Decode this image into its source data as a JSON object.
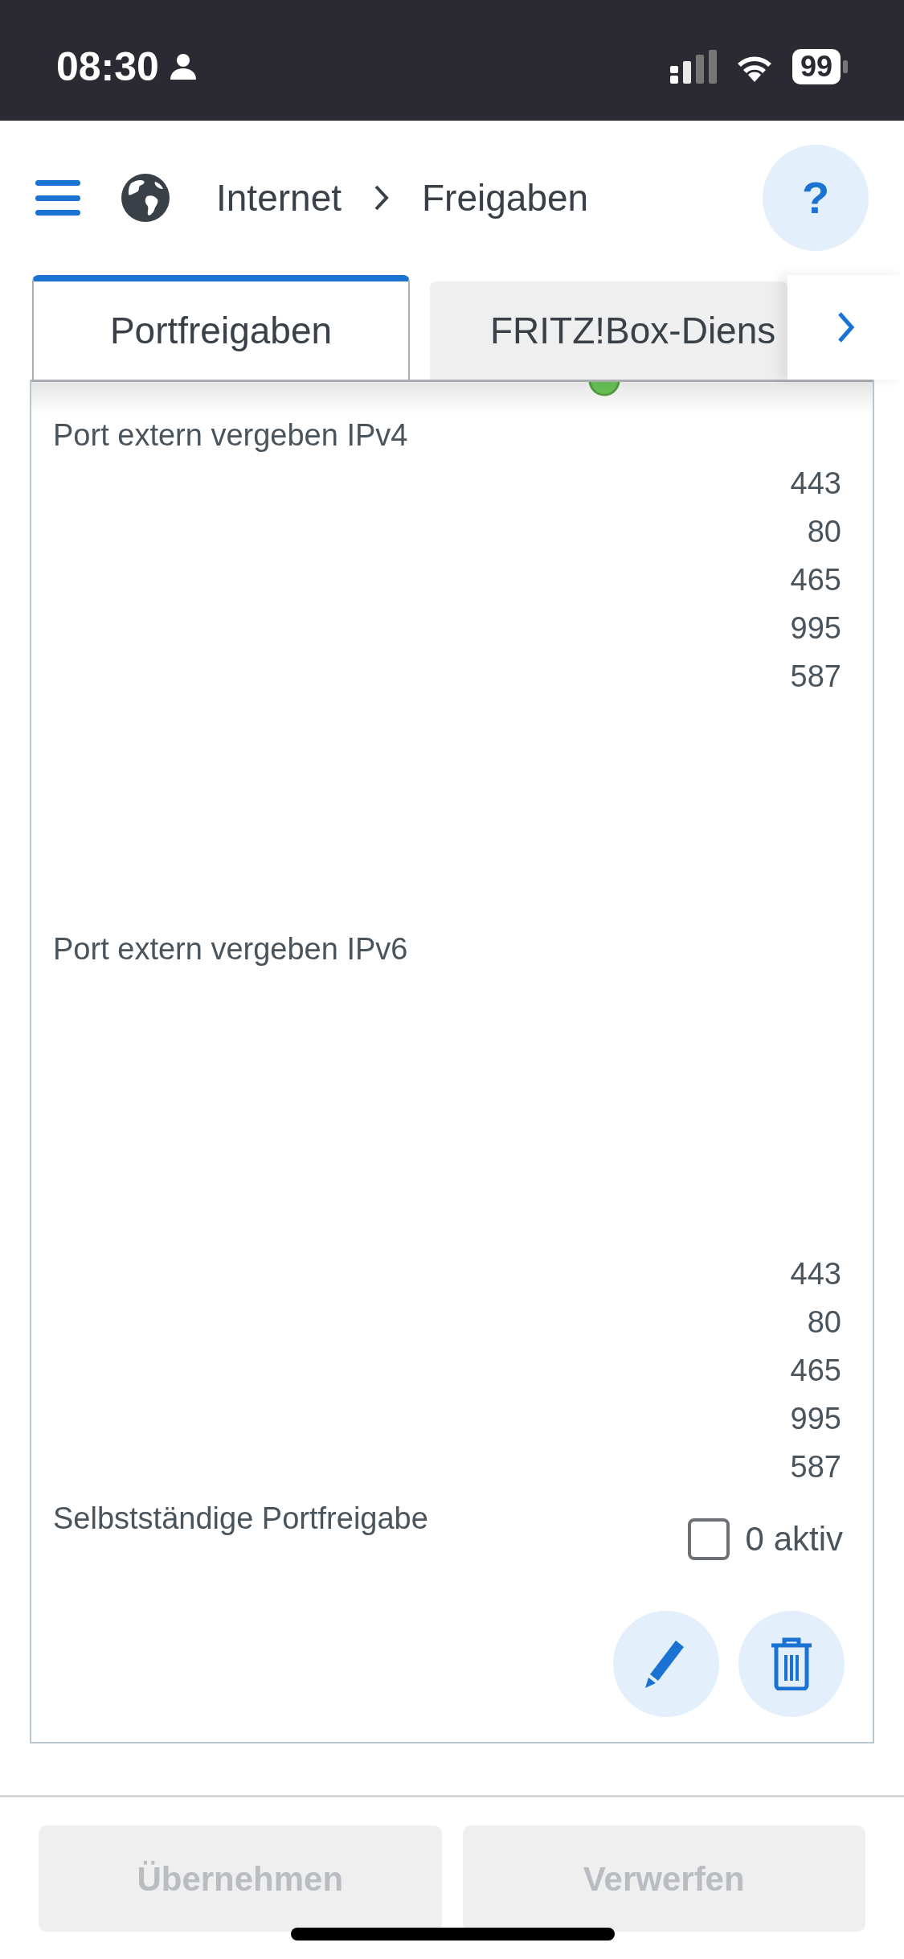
{
  "status_bar": {
    "time": "08:30",
    "battery": "99"
  },
  "header": {
    "breadcrumb": [
      "Internet",
      "Freigaben"
    ],
    "help": "?"
  },
  "tabs": [
    {
      "label": "Portfreigaben",
      "selected": true
    },
    {
      "label": "FRITZ!Box-Diens",
      "selected": false
    }
  ],
  "sections": [
    {
      "label": "Port extern vergeben IPv4",
      "ports": [
        "443",
        "80",
        "465",
        "995",
        "587"
      ]
    },
    {
      "label": "Port extern vergeben IPv6",
      "ports": [
        "443",
        "80",
        "465",
        "995",
        "587"
      ]
    }
  ],
  "self_sharing": {
    "label": "Selbstständige Portfreigabe",
    "checked": false,
    "count": "0 aktiv"
  },
  "buttons": [
    {
      "label": "Übernehmen",
      "disabled": true
    },
    {
      "label": "Verwerfen",
      "disabled": true
    }
  ]
}
